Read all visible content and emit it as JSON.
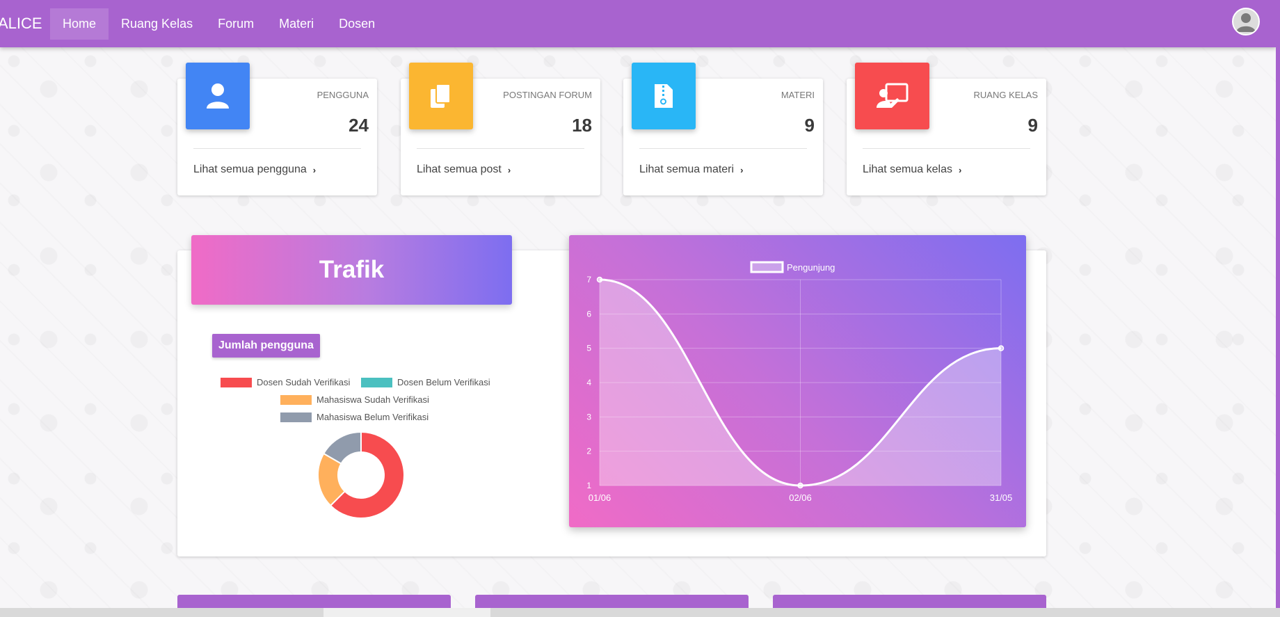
{
  "navbar": {
    "brand": "ALICE",
    "items": [
      {
        "label": "Home",
        "active": true
      },
      {
        "label": "Ruang Kelas",
        "active": false
      },
      {
        "label": "Forum",
        "active": false
      },
      {
        "label": "Materi",
        "active": false
      },
      {
        "label": "Dosen",
        "active": false
      }
    ],
    "avatar_icon": "user-avatar-icon"
  },
  "stats": [
    {
      "category": "PENGGUNA",
      "value": "24",
      "link": "Lihat semua pengguna",
      "color": "#4285f4",
      "icon": "user-icon"
    },
    {
      "category": "POSTINGAN FORUM",
      "value": "18",
      "link": "Lihat semua post",
      "color": "#fbb631",
      "icon": "copy-icon"
    },
    {
      "category": "MATERI",
      "value": "9",
      "link": "Lihat semua materi",
      "color": "#29b6f6",
      "icon": "file-zip-icon"
    },
    {
      "category": "RUANG KELAS",
      "value": "9",
      "link": "Lihat semua kelas",
      "color": "#f74c4f",
      "icon": "chalkboard-teacher-icon"
    }
  ],
  "traffic": {
    "title": "Trafik",
    "badge": "Jumlah pengguna"
  },
  "chart_data": [
    {
      "type": "pie",
      "variant": "doughnut",
      "categories": [
        "Dosen Sudah Verifikasi",
        "Dosen Belum Verifikasi",
        "Mahasiswa Sudah Verifikasi",
        "Mahasiswa Belum Verifikasi"
      ],
      "values": [
        15,
        0,
        5,
        4
      ],
      "colors": [
        "#f74c4f",
        "#4bc0c0",
        "#ffb05c",
        "#909bac"
      ],
      "legend": "top"
    },
    {
      "type": "area",
      "categories": [
        "01/06",
        "02/06",
        "31/05"
      ],
      "series": [
        {
          "name": "Pengunjung",
          "values": [
            7,
            1,
            5
          ]
        }
      ],
      "ylim": [
        1,
        7
      ],
      "yticks": [
        "1",
        "2",
        "3",
        "4",
        "5",
        "6",
        "7"
      ],
      "grid": true,
      "legend": "top"
    }
  ],
  "bottom_cards": [
    "",
    "",
    ""
  ]
}
